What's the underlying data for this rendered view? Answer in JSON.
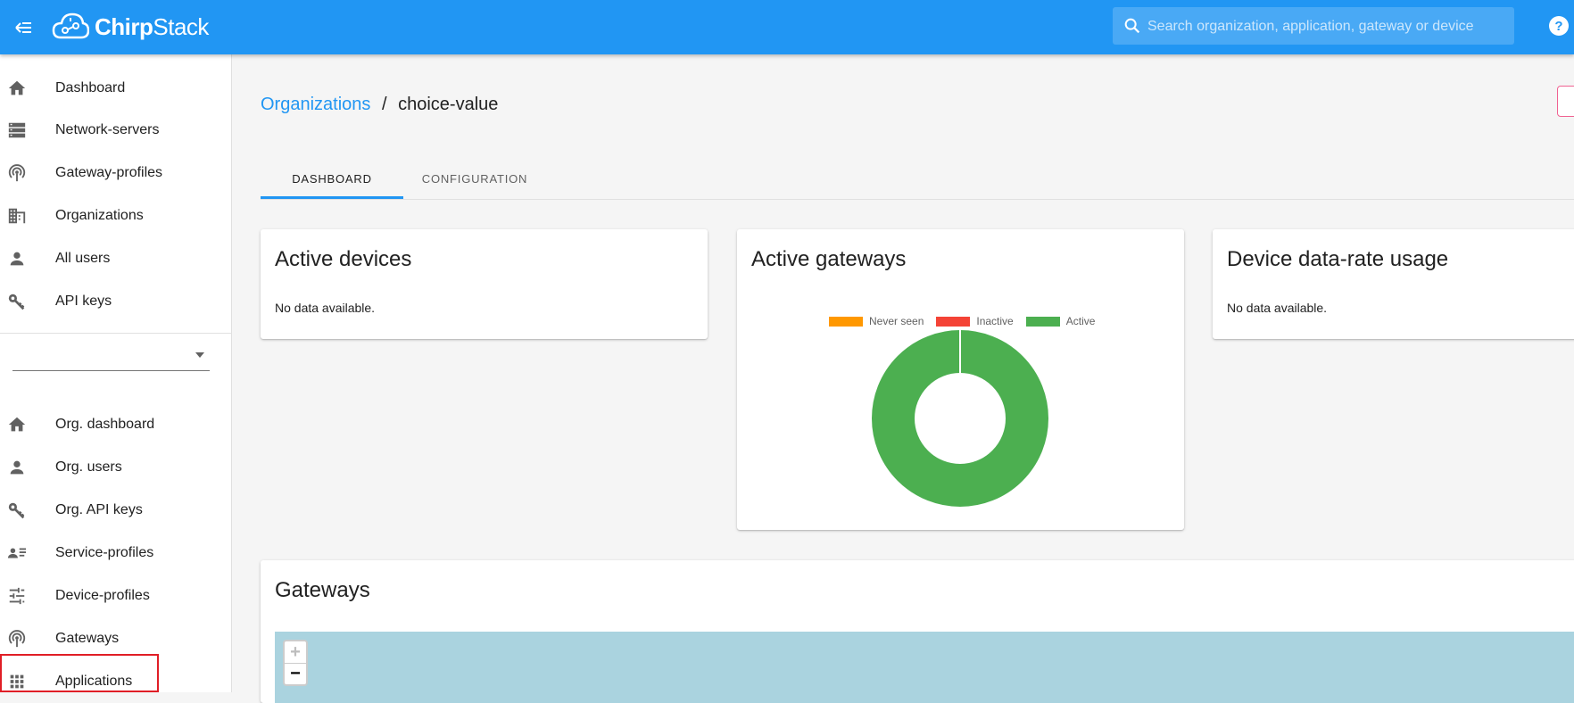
{
  "app": {
    "brand_chirp": "Chirp",
    "brand_stack": "Stack",
    "accent_color": "#2196f3"
  },
  "header": {
    "search_placeholder": "Search organization, application, gateway or device"
  },
  "sidebar": {
    "global_items": [
      {
        "label": "Dashboard",
        "icon": "home-icon"
      },
      {
        "label": "Network-servers",
        "icon": "server-icon"
      },
      {
        "label": "Gateway-profiles",
        "icon": "gateway-icon"
      },
      {
        "label": "Organizations",
        "icon": "domain-icon"
      },
      {
        "label": "All users",
        "icon": "account-icon"
      },
      {
        "label": "API keys",
        "icon": "key-icon"
      }
    ],
    "org_items": [
      {
        "label": "Org. dashboard",
        "icon": "home-icon"
      },
      {
        "label": "Org. users",
        "icon": "account-icon"
      },
      {
        "label": "Org. API keys",
        "icon": "key-icon"
      },
      {
        "label": "Service-profiles",
        "icon": "account-details-icon"
      },
      {
        "label": "Device-profiles",
        "icon": "tune-icon"
      },
      {
        "label": "Gateways",
        "icon": "gateway-icon"
      },
      {
        "label": "Applications",
        "icon": "apps-icon"
      }
    ]
  },
  "breadcrumb": {
    "parent": "Organizations",
    "separator": "/",
    "current": "choice-value"
  },
  "tabs": [
    {
      "label": "DASHBOARD",
      "active": true
    },
    {
      "label": "CONFIGURATION",
      "active": false
    }
  ],
  "cards": {
    "active_devices": {
      "title": "Active devices",
      "body": "No data available."
    },
    "active_gateways": {
      "title": "Active gateways"
    },
    "data_rate": {
      "title": "Device data-rate usage",
      "body": "No data available."
    },
    "gateways_map": {
      "title": "Gateways"
    }
  },
  "map": {
    "zoom_in": "+",
    "zoom_out": "−"
  },
  "chart_data": {
    "type": "pie",
    "legend_position": "top",
    "series": [
      {
        "name": "Never seen",
        "value": 0,
        "color": "#ff9800"
      },
      {
        "name": "Inactive",
        "value": 0,
        "color": "#f44336"
      },
      {
        "name": "Active",
        "value": 1,
        "color": "#4caf50"
      }
    ]
  }
}
